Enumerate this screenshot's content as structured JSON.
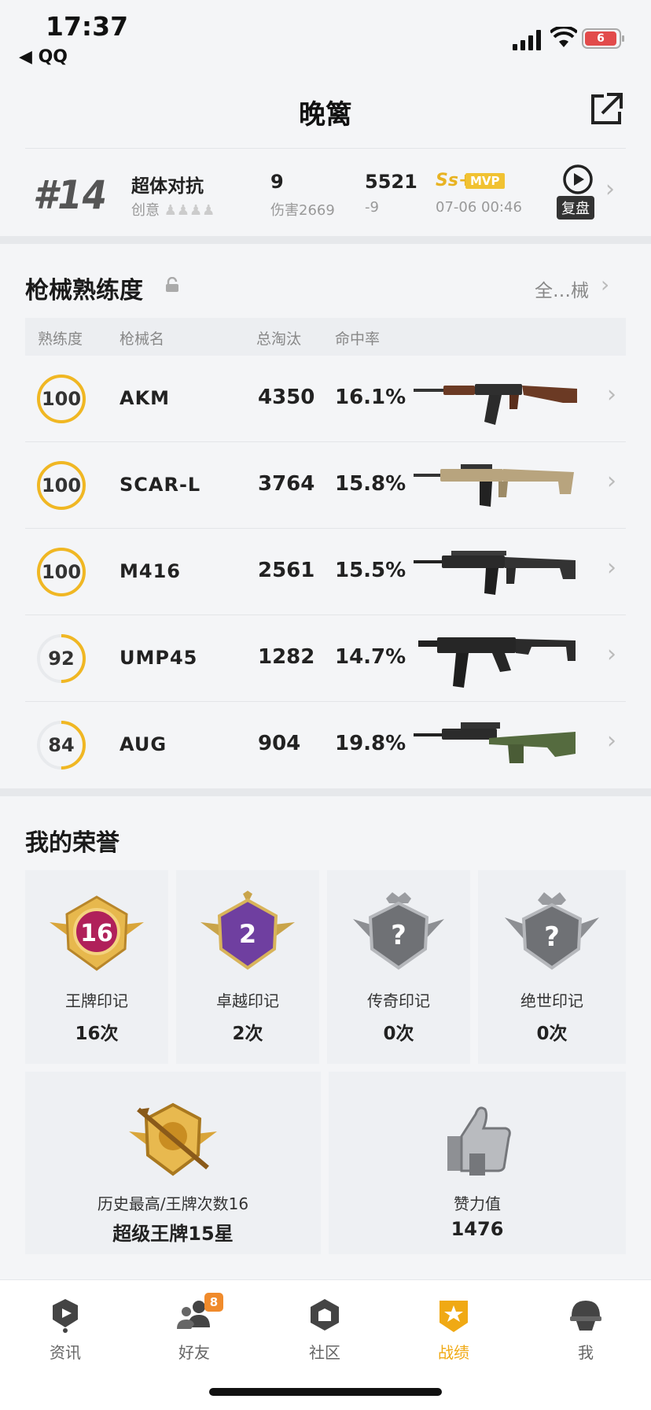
{
  "status_bar": {
    "time": "17:37",
    "back_app": "QQ",
    "battery": "6"
  },
  "header": {
    "title": "晚篱"
  },
  "match": {
    "rank": "#14",
    "mode": "超体对抗",
    "mode_sub": "创意",
    "kills": "9",
    "damage": "伤害2669",
    "score": "5521",
    "score_change": "-9",
    "grade": "Ss+",
    "mvp": "MVP",
    "time": "07-06 00:46",
    "replay_label": "复盘"
  },
  "weapons": {
    "title": "枪械熟练度",
    "all_link": "全…械",
    "headers": {
      "proficiency": "熟练度",
      "name": "枪械名",
      "kills": "总淘汰",
      "accuracy": "命中率"
    },
    "rows": [
      {
        "proficiency": "100",
        "name": "AKM",
        "kills": "4350",
        "accuracy": "16.1%",
        "progress": 1.0
      },
      {
        "proficiency": "100",
        "name": "SCAR-L",
        "kills": "3764",
        "accuracy": "15.8%",
        "progress": 1.0
      },
      {
        "proficiency": "100",
        "name": "M416",
        "kills": "2561",
        "accuracy": "15.5%",
        "progress": 1.0
      },
      {
        "proficiency": "92",
        "name": "UMP45",
        "kills": "1282",
        "accuracy": "14.7%",
        "progress": 0.5
      },
      {
        "proficiency": "84",
        "name": "AUG",
        "kills": "904",
        "accuracy": "19.8%",
        "progress": 0.5
      }
    ]
  },
  "honors": {
    "title": "我的荣誉",
    "items": [
      {
        "name": "王牌印记",
        "count": "16次",
        "badge_number": "16"
      },
      {
        "name": "卓越印记",
        "count": "2次",
        "badge_number": "2"
      },
      {
        "name": "传奇印记",
        "count": "0次",
        "badge_number": "?"
      },
      {
        "name": "绝世印记",
        "count": "0次",
        "badge_number": "?"
      }
    ],
    "best": {
      "name": "历史最高/王牌次数16",
      "value": "超级王牌15星"
    },
    "likes": {
      "name": "赞力值",
      "value": "1476"
    }
  },
  "tabbar": {
    "tabs": [
      {
        "label": "资讯",
        "icon": "news-icon"
      },
      {
        "label": "好友",
        "icon": "friends-icon",
        "badge": "8"
      },
      {
        "label": "社区",
        "icon": "community-icon"
      },
      {
        "label": "战绩",
        "icon": "record-icon",
        "active": true
      },
      {
        "label": "我",
        "icon": "profile-icon"
      }
    ]
  },
  "colors": {
    "accent": "#f0a914",
    "ring": "#f0b723",
    "badge": "#f08b2c"
  }
}
